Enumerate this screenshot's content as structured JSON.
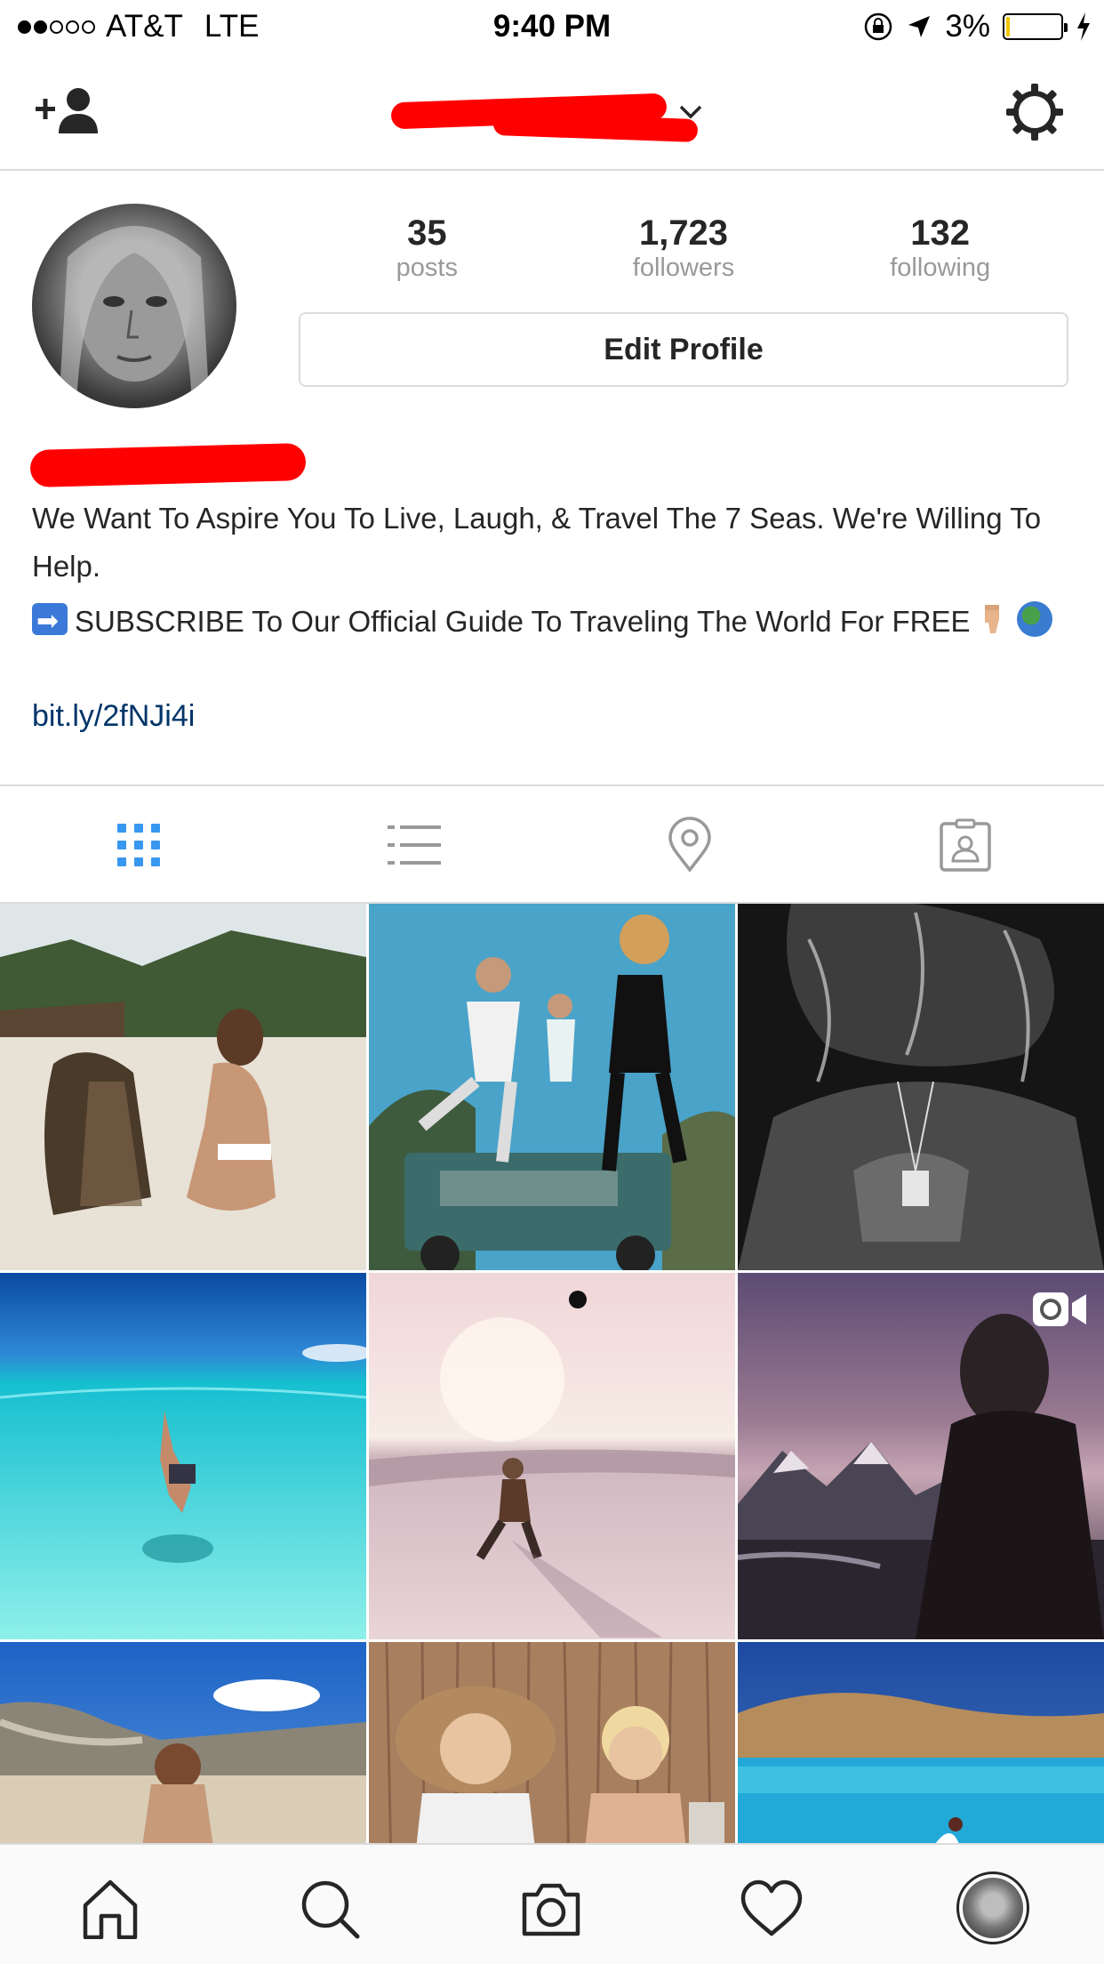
{
  "status_bar": {
    "carrier": "AT&T",
    "network": "LTE",
    "time": "9:40 PM",
    "battery": "3%",
    "signal_bars_filled": 2,
    "signal_bars_total": 5
  },
  "nav": {
    "username": "",
    "icons": [
      "add-user-icon",
      "chevron-down-icon",
      "settings-gear-icon"
    ]
  },
  "profile": {
    "stats": [
      {
        "value": "35",
        "label": "posts"
      },
      {
        "value": "1,723",
        "label": "followers"
      },
      {
        "value": "132",
        "label": "following"
      }
    ],
    "edit_button": "Edit Profile",
    "full_name": "",
    "bio_line1": "We Want To Aspire You To Live, Laugh, & Travel The 7 Seas. We're Willing To Help.",
    "bio_line2": "SUBSCRIBE To Our Official Guide To Traveling The World For FREE",
    "link": "bit.ly/2fNJi4i"
  },
  "tabs": [
    "grid-view-icon",
    "list-view-icon",
    "location-pin-icon",
    "tagged-photos-icon"
  ],
  "active_tab": 0,
  "grid_posts": [
    {
      "scene": "beach-dog",
      "colors": [
        "#4e6b3e",
        "#cfcac0",
        "#ece6dc"
      ]
    },
    {
      "scene": "jeep-jump",
      "colors": [
        "#4aa3c9",
        "#3b6b5e",
        "#d5cdb8"
      ]
    },
    {
      "scene": "bw-portrait",
      "colors": [
        "#1a1a1a",
        "#5a5a5a",
        "#222222"
      ]
    },
    {
      "scene": "underwater-dive",
      "colors": [
        "#1f5fb0",
        "#2ed0d8",
        "#9af0ea"
      ]
    },
    {
      "scene": "sunset-surf",
      "colors": [
        "#f4dcd8",
        "#e8c0c6",
        "#d9c1c4"
      ]
    },
    {
      "scene": "mountain-silhouette",
      "colors": [
        "#7a5d75",
        "#3a2a35",
        "#2a1e26"
      ]
    },
    {
      "scene": "beach-woman",
      "colors": [
        "#2f76c8",
        "#bfb6a6",
        "#e4d8c2"
      ]
    },
    {
      "scene": "kids-straw",
      "colors": [
        "#9a6c4e",
        "#c69b78",
        "#e6d6c8"
      ]
    },
    {
      "scene": "blue-bay",
      "colors": [
        "#1e4f96",
        "#b98b5a",
        "#23a9d6"
      ]
    }
  ],
  "bottom_nav": [
    "home-icon",
    "search-icon",
    "camera-icon",
    "heart-icon",
    "profile-avatar"
  ],
  "colors": {
    "accent": "#3897f0",
    "link": "#003569",
    "redaction": "#ff0000"
  }
}
